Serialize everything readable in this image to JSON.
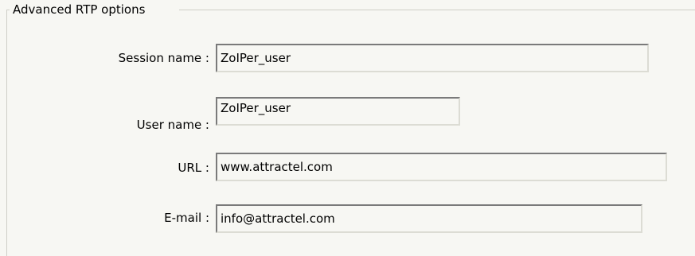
{
  "group": {
    "title": "Advanced RTP options"
  },
  "fields": {
    "session_name": {
      "label": "Session name :",
      "value": "ZoIPer_user"
    },
    "user_name": {
      "label": "User name :",
      "value": "ZoIPer_user"
    },
    "url": {
      "label": "URL :",
      "value": "www.attractel.com"
    },
    "email": {
      "label": "E-mail :",
      "value": "info@attractel.com"
    }
  }
}
